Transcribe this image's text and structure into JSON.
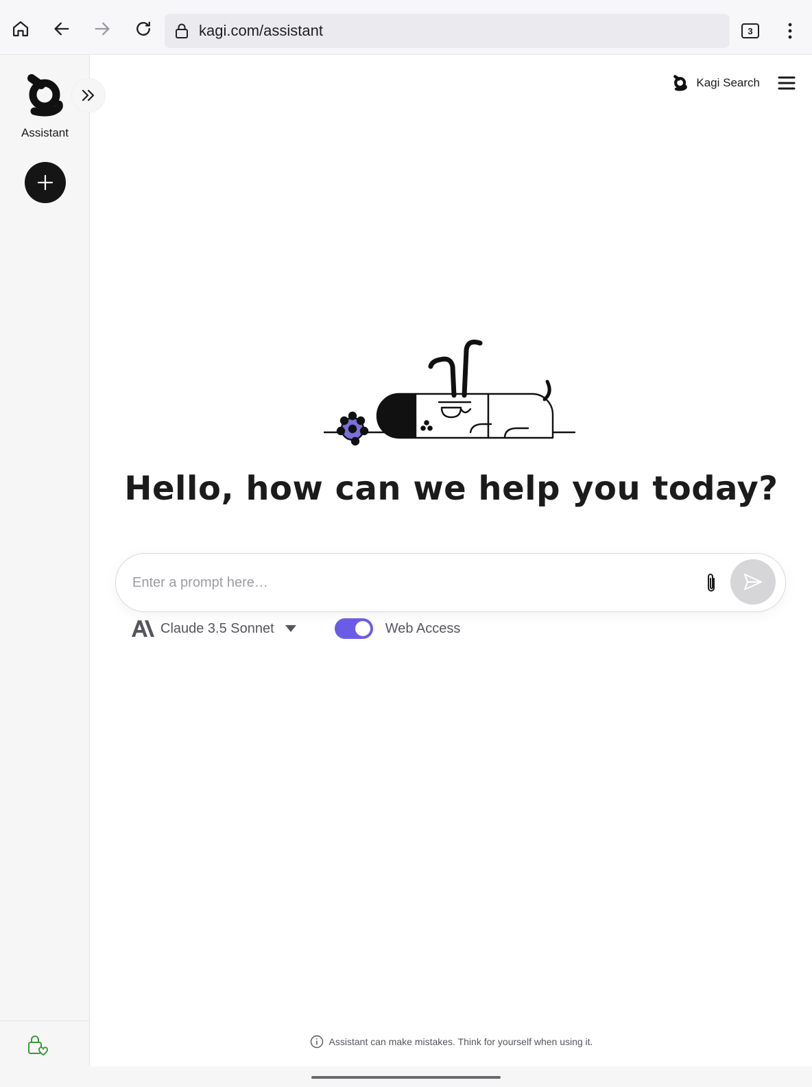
{
  "browser": {
    "url": "kagi.com/assistant",
    "tab_count": "3"
  },
  "sidebar": {
    "logo_label": "Assistant"
  },
  "header": {
    "kagi_search_label": "Kagi Search"
  },
  "main": {
    "greeting": "Hello, how can we help you today?",
    "prompt_placeholder": "Enter a prompt here…",
    "model_name": "Claude 3.5 Sonnet",
    "web_access_label": "Web Access",
    "web_access_enabled": true,
    "disclaimer": "Assistant can make mistakes. Think for yourself when using it."
  },
  "colors": {
    "accent": "#6b5ce7",
    "new_chat_button": "#151515",
    "sidebar_bg": "#f6f6f7",
    "privacy_icon": "#3a9a3a"
  }
}
